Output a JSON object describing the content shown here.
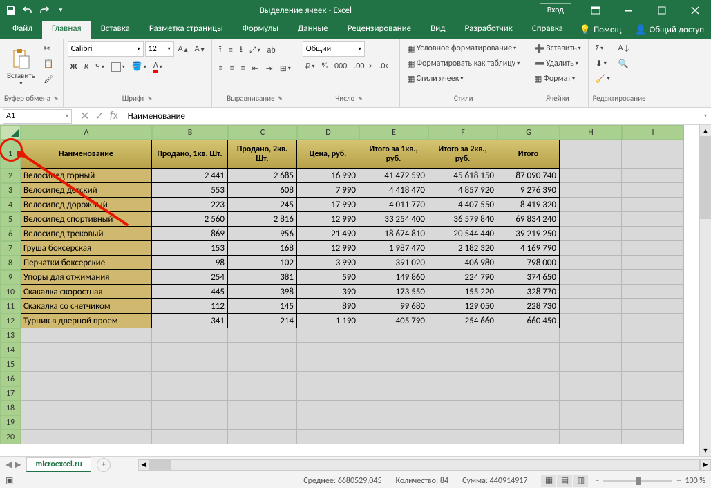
{
  "title": "Выделение ячеек  -  Excel",
  "login": "Вход",
  "tabs": [
    "Файл",
    "Главная",
    "Вставка",
    "Разметка страницы",
    "Формулы",
    "Данные",
    "Рецензирование",
    "Вид",
    "Разработчик",
    "Справка"
  ],
  "active_tab": 1,
  "help_btn": "Помощ",
  "share_btn": "Общий доступ",
  "ribbon": {
    "clipboard": {
      "paste": "Вставить",
      "label": "Буфер обмена"
    },
    "font": {
      "name": "Calibri",
      "size": "12",
      "label": "Шрифт",
      "bold": "Ж",
      "italic": "К",
      "underline": "Ч"
    },
    "align": {
      "label": "Выравнивание"
    },
    "number": {
      "format": "Общий",
      "label": "Число"
    },
    "styles": {
      "cond": "Условное форматирование",
      "table": "Форматировать как таблицу",
      "cell": "Стили ячеек",
      "label": "Стили"
    },
    "cells": {
      "insert": "Вставить",
      "delete": "Удалить",
      "format": "Формат",
      "label": "Ячейки"
    },
    "editing": {
      "label": "Редактирование"
    }
  },
  "namebox": "A1",
  "formula": "Наименование",
  "columns": [
    "A",
    "B",
    "C",
    "D",
    "E",
    "F",
    "G",
    "H",
    "I"
  ],
  "headers": [
    "Наименование",
    "Продано, 1кв. Шт.",
    "Продано, 2кв. Шт.",
    "Цена, руб.",
    "Итого за 1кв., руб.",
    "Итого за 2кв., руб.",
    "Итого"
  ],
  "rows": [
    {
      "n": "Велосипед горный",
      "v": [
        "2 441",
        "2 685",
        "16 990",
        "41 472 590",
        "45 618 150",
        "87 090 740"
      ]
    },
    {
      "n": "Велосипед детский",
      "v": [
        "553",
        "608",
        "7 990",
        "4 418 470",
        "4 857 920",
        "9 276 390"
      ]
    },
    {
      "n": "Велосипед дорожный",
      "v": [
        "223",
        "245",
        "17 990",
        "4 011 770",
        "4 407 550",
        "8 419 320"
      ]
    },
    {
      "n": "Велосипед спортивный",
      "v": [
        "2 560",
        "2 816",
        "12 990",
        "33 254 400",
        "36 579 840",
        "69 834 240"
      ]
    },
    {
      "n": "Велосипед трековый",
      "v": [
        "869",
        "956",
        "21 490",
        "18 674 810",
        "20 544 440",
        "39 219 250"
      ]
    },
    {
      "n": "Груша боксерская",
      "v": [
        "153",
        "168",
        "12 990",
        "1 987 470",
        "2 182 320",
        "4 169 790"
      ]
    },
    {
      "n": "Перчатки боксерские",
      "v": [
        "98",
        "102",
        "3 990",
        "391 020",
        "406 980",
        "798 000"
      ]
    },
    {
      "n": "Упоры для отжимания",
      "v": [
        "254",
        "381",
        "590",
        "149 860",
        "224 790",
        "374 650"
      ]
    },
    {
      "n": "Скакалка скоростная",
      "v": [
        "445",
        "398",
        "390",
        "173 550",
        "155 220",
        "328 770"
      ]
    },
    {
      "n": "Скакалка со счетчиком",
      "v": [
        "112",
        "145",
        "890",
        "99 680",
        "129 050",
        "228 730"
      ]
    },
    {
      "n": "Турник в дверной проем",
      "v": [
        "341",
        "214",
        "1 190",
        "405 790",
        "254 660",
        "660 450"
      ]
    }
  ],
  "sheet_name": "microexcel.ru",
  "status": {
    "avg": "Среднее: 6680529,045",
    "count": "Количество: 84",
    "sum": "Сумма: 440914917",
    "zoom": "100 %"
  },
  "chart_data": null
}
